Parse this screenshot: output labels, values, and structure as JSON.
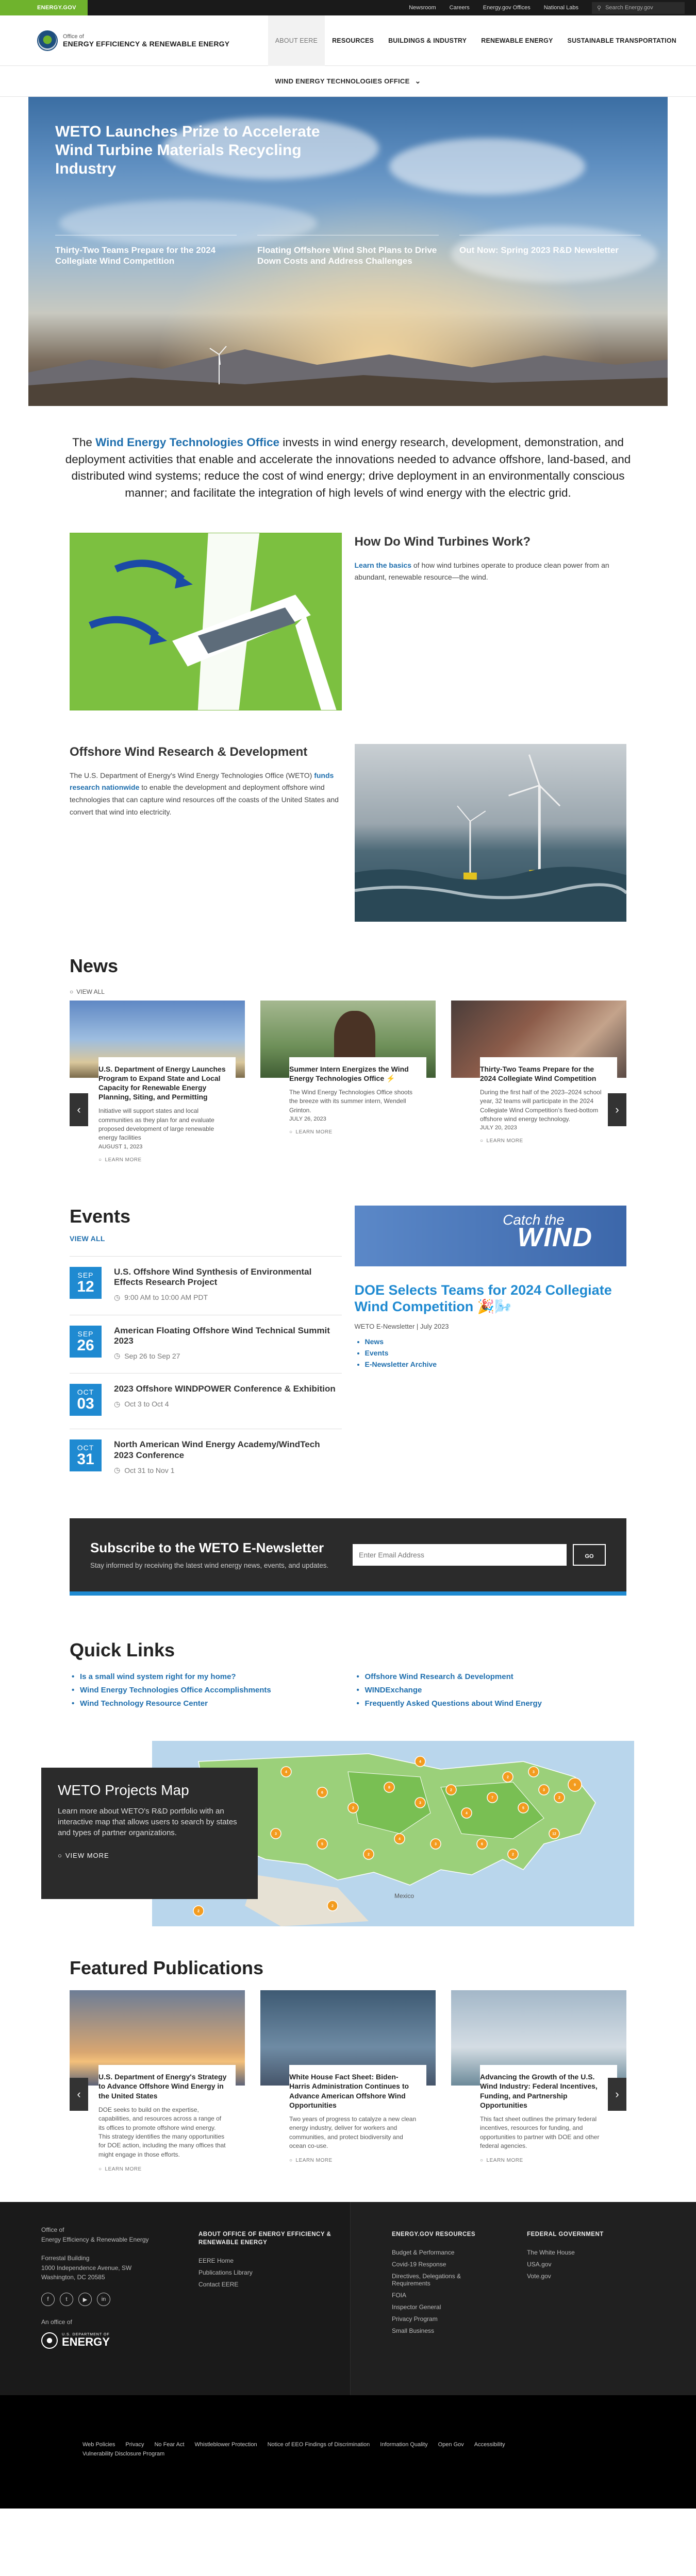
{
  "util": {
    "brand": "ENERGY.GOV",
    "links": [
      "Newsroom",
      "Careers",
      "Energy.gov Offices",
      "National Labs"
    ],
    "search_placeholder": "Search Energy.gov"
  },
  "header": {
    "office_of": "Office of",
    "office_name": "ENERGY EFFICIENCY & RENEWABLE ENERGY",
    "nav": [
      "ABOUT EERE",
      "RESOURCES",
      "BUILDINGS & INDUSTRY",
      "RENEWABLE ENERGY",
      "SUSTAINABLE TRANSPORTATION"
    ]
  },
  "subnav": {
    "label": "WIND ENERGY TECHNOLOGIES OFFICE"
  },
  "hero": {
    "title": "WETO Launches Prize to Accelerate Wind Turbine Materials Recycling Industry",
    "features": [
      "Thirty-Two Teams Prepare for the 2024 Collegiate Wind Competition",
      "Floating Offshore Wind Shot Plans to Drive Down Costs and Address Challenges",
      "Out Now: Spring 2023 R&D Newsletter"
    ]
  },
  "mission": {
    "pre": "The ",
    "office": "Wind Energy Technologies Office",
    "post": " invests in wind energy research, development, demonstration, and deployment activities that enable and accelerate the innovations needed to advance offshore, land-based, and distributed wind systems; reduce the cost of wind energy; drive deployment in an environmentally conscious manner; and facilitate the integration of high levels of wind energy with the electric grid."
  },
  "how": {
    "title": "How Do Wind Turbines Work?",
    "link": "Learn the basics",
    "text": " of how wind turbines operate to produce clean power from an abundant, renewable resource—the wind."
  },
  "offshore": {
    "title": "Offshore Wind Research & Development",
    "pre": "The U.S. Department of Energy's Wind Energy Technologies Office (WETO) ",
    "link": "funds research nationwide",
    "post": " to enable the development and deployment offshore wind technologies that can capture wind resources off the coasts of the United States and convert that wind into electricity."
  },
  "news": {
    "title": "News",
    "view_all": "VIEW ALL",
    "learn_more": "LEARN MORE",
    "items": [
      {
        "title": "U.S. Department of Energy Launches Program to Expand State and Local Capacity for Renewable Energy Planning, Siting, and Permitting",
        "text": "Initiative will support states and local communities as they plan for and evaluate proposed development of large renewable energy facilities",
        "date": "AUGUST 1, 2023"
      },
      {
        "title": "Summer Intern Energizes the Wind Energy Technologies Office ⚡",
        "text": "The Wind Energy Technologies Office shoots the breeze with its summer intern, Wendell Grinton.",
        "date": "JULY 26, 2023"
      },
      {
        "title": "Thirty-Two Teams Prepare for the 2024 Collegiate Wind Competition",
        "text": "During the first half of the 2023–2024 school year, 32 teams will participate in the 2024 Collegiate Wind Competition’s fixed-bottom offshore wind energy technology.",
        "date": "JULY 20, 2023"
      }
    ]
  },
  "events": {
    "title": "Events",
    "view_all": "VIEW ALL",
    "items": [
      {
        "month": "SEP",
        "day": "12",
        "title": "U.S. Offshore Wind Synthesis of Environmental Effects Research Project",
        "time": "9:00 AM to 10:00 AM PDT"
      },
      {
        "month": "SEP",
        "day": "26",
        "title": "American Floating Offshore Wind Technical Summit 2023",
        "time": "Sep 26 to Sep 27"
      },
      {
        "month": "OCT",
        "day": "03",
        "title": "2023 Offshore WINDPOWER Conference & Exhibition",
        "time": "Oct 3 to Oct 4"
      },
      {
        "month": "OCT",
        "day": "31",
        "title": "North American Wind Energy Academy/WindTech 2023 Conference",
        "time": "Oct 31 to Nov 1"
      }
    ]
  },
  "newsletter_promo": {
    "banner_catch": "Catch the",
    "banner_wind": "WIND",
    "title": "DOE Selects Teams for 2024 Collegiate Wind Competition 🎉🌬️",
    "subtitle": "WETO E-Newsletter | July 2023",
    "links": [
      "News",
      "Events",
      "E-Newsletter Archive"
    ]
  },
  "subscribe": {
    "title": "Subscribe to the WETO E-Newsletter",
    "text": "Stay informed by receiving the latest wind energy news, events, and updates.",
    "placeholder": "Enter Email Address",
    "button": "GO"
  },
  "quick_links": {
    "title": "Quick Links",
    "left": [
      "Is a small wind system right for my home?",
      "Wind Energy Technologies Office Accomplishments",
      "Wind Technology Resource Center"
    ],
    "right": [
      "Offshore Wind Research & Development",
      "WINDExchange",
      "Frequently Asked Questions about Wind Energy"
    ]
  },
  "map": {
    "title": "WETO Projects Map",
    "text": "Learn more about WETO's R&D portfolio with an interactive map that allows users to search by states and types of partner organizations.",
    "cta": "VIEW MORE",
    "country_label": "Mexico",
    "marker_counts": [
      "3",
      "2",
      "5",
      "4",
      "6",
      "2",
      "8",
      "3",
      "2",
      "4",
      "7",
      "2",
      "5",
      "3",
      "2",
      "9",
      "4",
      "3",
      "6",
      "2",
      "2",
      "5",
      "3",
      "12",
      "4",
      "3",
      "2",
      "2"
    ]
  },
  "publications": {
    "title": "Featured Publications",
    "learn_more": "LEARN MORE",
    "items": [
      {
        "title": "U.S. Department of Energy's Strategy to Advance Offshore Wind Energy in the United States",
        "text": "DOE seeks to build on the expertise, capabilities, and resources across a range of its offices to promote offshore wind energy. This strategy identifies the many opportunities for DOE action, including the many offices that might engage in those efforts."
      },
      {
        "title": "White House Fact Sheet: Biden-Harris Administration Continues to Advance American Offshore Wind Opportunities",
        "text": "Two years of progress to catalyze a new clean energy industry, deliver for workers and communities, and protect biodiversity and ocean co-use."
      },
      {
        "title": "Advancing the Growth of the U.S. Wind Industry: Federal Incentives, Funding, and Partnership Opportunities",
        "text": "This fact sheet outlines the primary federal incentives, resources for funding, and opportunities to partner with DOE and other federal agencies."
      }
    ]
  },
  "footer": {
    "office_line1": "Office of",
    "office_line2": "Energy Efficiency & Renewable Energy",
    "address": [
      "Forrestal Building",
      "1000 Independence Avenue, SW",
      "Washington, DC 20585"
    ],
    "socials": [
      "f",
      "t",
      "▶",
      "in"
    ],
    "office_of_label": "An office of",
    "doe_pre": "U.S. DEPARTMENT OF",
    "doe_word": "ENERGY",
    "about_head": "ABOUT OFFICE OF ENERGY EFFICIENCY & RENEWABLE ENERGY",
    "about_links": [
      "EERE Home",
      "Publications Library",
      "Contact EERE"
    ],
    "resources_head": "ENERGY.GOV RESOURCES",
    "resources_links": [
      "Budget & Performance",
      "Covid-19 Response",
      "Directives, Delegations & Requirements",
      "FOIA",
      "Inspector General",
      "Privacy Program",
      "Small Business"
    ],
    "fed_head": "FEDERAL GOVERNMENT",
    "fed_links": [
      "The White House",
      "USA.gov",
      "Vote.gov"
    ]
  },
  "bottom_links": [
    "Web Policies",
    "Privacy",
    "No Fear Act",
    "Whistleblower Protection",
    "Notice of EEO Findings of Discrimination",
    "Information Quality",
    "Open Gov",
    "Accessibility",
    "Vulnerability Disclosure Program"
  ]
}
